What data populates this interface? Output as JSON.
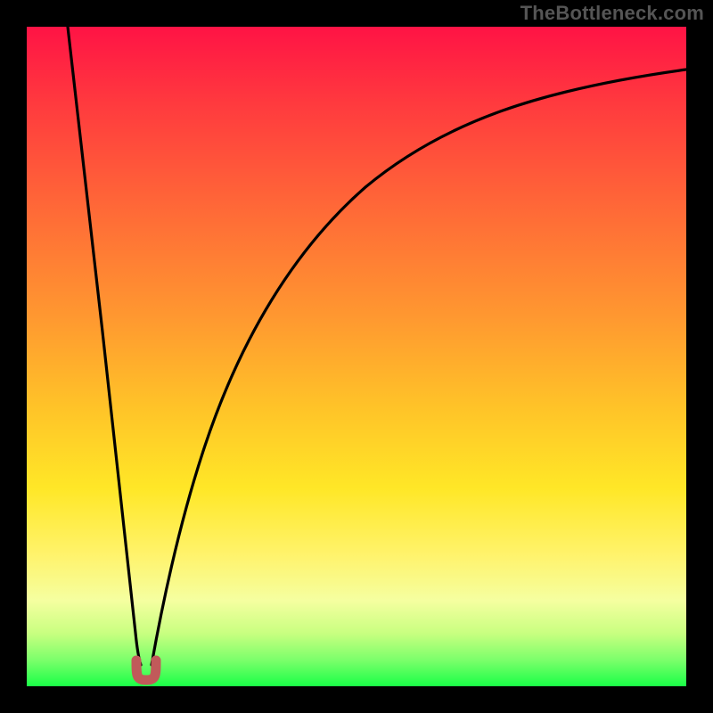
{
  "watermark": "TheBottleneck.com",
  "chart_data": {
    "type": "line",
    "title": "",
    "xlabel": "",
    "ylabel": "",
    "xlim": [
      0,
      100
    ],
    "ylim": [
      0,
      100
    ],
    "grid": false,
    "legend": false,
    "annotations": [],
    "colors": {
      "top": "#ff1345",
      "mid_high": "#ff9830",
      "mid": "#ffe727",
      "mid_low": "#f5ffa0",
      "bottom": "#1aff47",
      "curve": "#000000",
      "marker": "#c15a5a"
    },
    "series": [
      {
        "name": "bottleneck-curve",
        "x": [
          6,
          8,
          10,
          12,
          14,
          15,
          16,
          17,
          18,
          19,
          20,
          22,
          24,
          28,
          34,
          42,
          52,
          64,
          78,
          92,
          100
        ],
        "y": [
          100,
          82,
          64,
          46,
          28,
          19,
          10,
          4,
          2,
          4,
          10,
          24,
          36,
          52,
          65,
          75,
          82,
          87,
          90,
          92,
          93
        ]
      }
    ],
    "marker": {
      "x": 17,
      "y": 2,
      "shape": "u",
      "label": ""
    }
  }
}
